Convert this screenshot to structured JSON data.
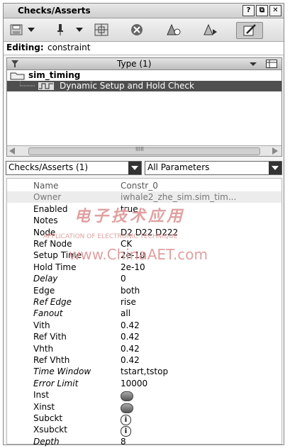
{
  "window": {
    "title": "Checks/Asserts"
  },
  "titlebar_buttons": [
    "?",
    "⧉",
    "✕"
  ],
  "toolbar": {
    "icons": [
      "save-icon",
      "dropdown-icon",
      "pin-icon",
      "dropdown-icon",
      "grid-icon",
      "clear-icon",
      "highlight-icon",
      "highlight-next-icon",
      "edit-icon"
    ]
  },
  "editing": {
    "label": "Editing:",
    "value": "constraint"
  },
  "tree": {
    "header": "Type (1)",
    "group": "sim_timing",
    "item": "Dynamic Setup and Hold Check",
    "scroll_label": "IIIII"
  },
  "filters": {
    "left": "Checks/Asserts (1)",
    "right": "All Parameters"
  },
  "properties": [
    {
      "name": "Name",
      "value": "Constr_0",
      "italic": false
    },
    {
      "name": "Owner",
      "value": "iwhale2_zhe_sim.sim_tim...",
      "italic": false
    },
    {
      "name": "Enabled",
      "value": "true",
      "italic": false
    },
    {
      "name": "Notes",
      "value": "",
      "italic": false
    },
    {
      "name": "Node",
      "value": "D2 D22 D222",
      "italic": false
    },
    {
      "name": "Ref Node",
      "value": "CK",
      "italic": false
    },
    {
      "name": "Setup Time",
      "value": "2e-10",
      "italic": false
    },
    {
      "name": "Hold Time",
      "value": "2e-10",
      "italic": false
    },
    {
      "name": "Delay",
      "value": "0",
      "italic": true
    },
    {
      "name": "Edge",
      "value": "both",
      "italic": false
    },
    {
      "name": "Ref Edge",
      "value": "rise",
      "italic": true
    },
    {
      "name": "Fanout",
      "value": "all",
      "italic": true
    },
    {
      "name": "Vith",
      "value": "0.42",
      "italic": false
    },
    {
      "name": "Ref Vith",
      "value": "0.42",
      "italic": false
    },
    {
      "name": "Vhth",
      "value": "0.42",
      "italic": false
    },
    {
      "name": "Ref Vhth",
      "value": "0.42",
      "italic": false
    },
    {
      "name": "Time Window",
      "value": "tstart,tstop",
      "italic": true
    },
    {
      "name": "Error Limit",
      "value": "10000",
      "italic": true
    },
    {
      "name": "Inst",
      "value": "",
      "italic": false,
      "badge": "obj"
    },
    {
      "name": "Xinst",
      "value": "",
      "italic": false,
      "badge": "obj"
    },
    {
      "name": "Subckt",
      "value": "",
      "italic": false,
      "badge": "i"
    },
    {
      "name": "Xsubckt",
      "value": "",
      "italic": false,
      "badge": "i"
    },
    {
      "name": "Depth",
      "value": "8",
      "italic": true
    }
  ],
  "watermark": {
    "line1": "电子技术应用",
    "line2": "APPLICATION OF ELECTRONIC TECHNIQUE",
    "line3": "www.ChinaAET.com",
    "color": "#e0a0a0"
  }
}
